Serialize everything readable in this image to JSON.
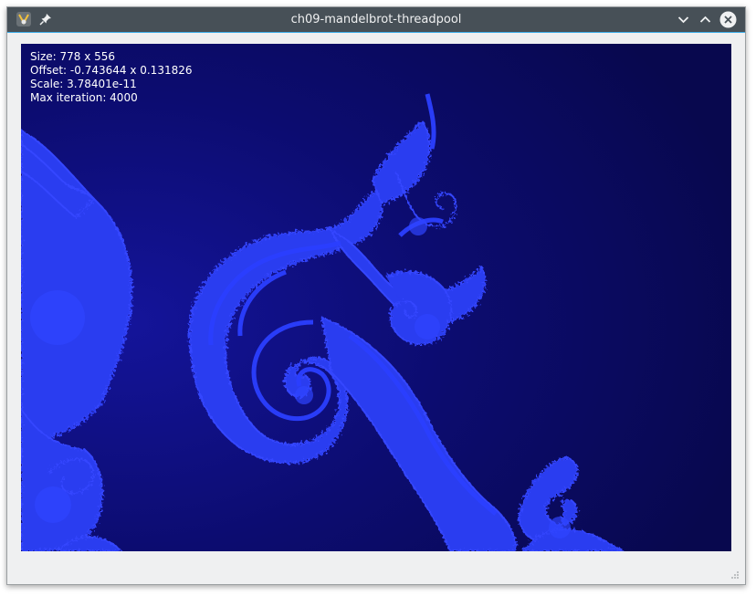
{
  "window": {
    "title": "ch09-mandelbrot-threadpool"
  },
  "titlebar_icons": {
    "app": "app-icon",
    "pin": "pin-icon",
    "minimize": "chevron-down-icon",
    "maximize": "chevron-up-icon",
    "close": "close-icon"
  },
  "info": {
    "size": "Size: 778 x 556",
    "offset": "Offset: -0.743644 x 0.131826",
    "scale": "Scale: 3.78401e-11",
    "max_iteration": "Max iteration: 4000"
  },
  "colors": {
    "titlebar": "#475057",
    "accent": "#3daee9",
    "fractal_background": "#0a0a55",
    "fractal_set": "#2a3cf0",
    "window_background": "#eff0f1"
  }
}
